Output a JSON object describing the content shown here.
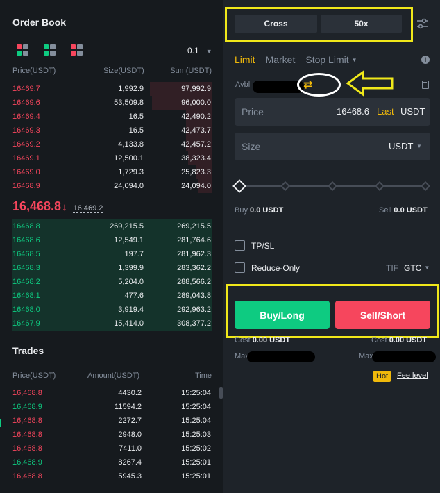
{
  "orderbook": {
    "title": "Order Book",
    "tick_size": "0.1",
    "headers": {
      "price": "Price(USDT)",
      "size": "Size(USDT)",
      "sum": "Sum(USDT)"
    },
    "asks": [
      {
        "price": "16469.7",
        "size": "1,992.9",
        "sum": "97,992.9",
        "depth": 0.31
      },
      {
        "price": "16469.6",
        "size": "53,509.8",
        "sum": "96,000.0",
        "depth": 0.3
      },
      {
        "price": "16469.4",
        "size": "16.5",
        "sum": "42,490.2",
        "depth": 0.13
      },
      {
        "price": "16469.3",
        "size": "16.5",
        "sum": "42,473.7",
        "depth": 0.13
      },
      {
        "price": "16469.2",
        "size": "4,133.8",
        "sum": "42,457.2",
        "depth": 0.13
      },
      {
        "price": "16469.1",
        "size": "12,500.1",
        "sum": "38,323.4",
        "depth": 0.12
      },
      {
        "price": "16469.0",
        "size": "1,729.3",
        "sum": "25,823.3",
        "depth": 0.08
      },
      {
        "price": "16468.9",
        "size": "24,094.0",
        "sum": "24,094.0",
        "depth": 0.07
      }
    ],
    "last_price": "16,468.8",
    "last_arrow": "↓",
    "mark_price": "16,469.2",
    "bids": [
      {
        "price": "16468.8",
        "size": "269,215.5",
        "sum": "269,215.5"
      },
      {
        "price": "16468.6",
        "size": "12,549.1",
        "sum": "281,764.6"
      },
      {
        "price": "16468.5",
        "size": "197.7",
        "sum": "281,962.3"
      },
      {
        "price": "16468.3",
        "size": "1,399.9",
        "sum": "283,362.2"
      },
      {
        "price": "16468.2",
        "size": "5,204.0",
        "sum": "288,566.2"
      },
      {
        "price": "16468.1",
        "size": "477.6",
        "sum": "289,043.8"
      },
      {
        "price": "16468.0",
        "size": "3,919.4",
        "sum": "292,963.2"
      },
      {
        "price": "16467.9",
        "size": "15,414.0",
        "sum": "308,377.2"
      }
    ]
  },
  "trades": {
    "title": "Trades",
    "headers": {
      "price": "Price(USDT)",
      "amount": "Amount(USDT)",
      "time": "Time"
    },
    "rows": [
      {
        "price": "16,468.8",
        "amount": "4430.2",
        "time": "15:25:04",
        "side": "sell"
      },
      {
        "price": "16,468.9",
        "amount": "11594.2",
        "time": "15:25:04",
        "side": "buy"
      },
      {
        "price": "16,468.8",
        "amount": "2272.7",
        "time": "15:25:04",
        "side": "sell"
      },
      {
        "price": "16,468.8",
        "amount": "2948.0",
        "time": "15:25:03",
        "side": "sell"
      },
      {
        "price": "16,468.8",
        "amount": "7411.0",
        "time": "15:25:02",
        "side": "sell"
      },
      {
        "price": "16,468.9",
        "amount": "8267.4",
        "time": "15:25:01",
        "side": "buy"
      },
      {
        "price": "16,468.8",
        "amount": "5945.3",
        "time": "15:25:01",
        "side": "sell"
      }
    ]
  },
  "order_form": {
    "margin_mode": "Cross",
    "leverage": "50x",
    "tabs": {
      "limit": "Limit",
      "market": "Market",
      "stop_limit": "Stop Limit"
    },
    "avbl_label": "Avbl",
    "swap_icon": "⇄",
    "price": {
      "label": "Price",
      "value": "16468.6",
      "last": "Last",
      "unit": "USDT"
    },
    "size": {
      "label": "Size",
      "unit": "USDT"
    },
    "buy_label": "Buy",
    "buy_value": "0.0 USDT",
    "sell_label": "Sell",
    "sell_value": "0.0 USDT",
    "tpsl": "TP/SL",
    "reduce_only": "Reduce-Only",
    "tif_label": "TIF",
    "tif_value": "GTC",
    "buy_long": "Buy/Long",
    "sell_short": "Sell/Short",
    "cost_label": "Cost",
    "cost_buy": "0.00 USDT",
    "cost_sell": "0.00 USDT",
    "max_label": "Max",
    "hot": "Hot",
    "fee_level": "Fee level"
  },
  "colors": {
    "up": "#0ecb81",
    "down": "#f6465d",
    "accent": "#f0b90b",
    "annotation": "#f0e81a"
  }
}
